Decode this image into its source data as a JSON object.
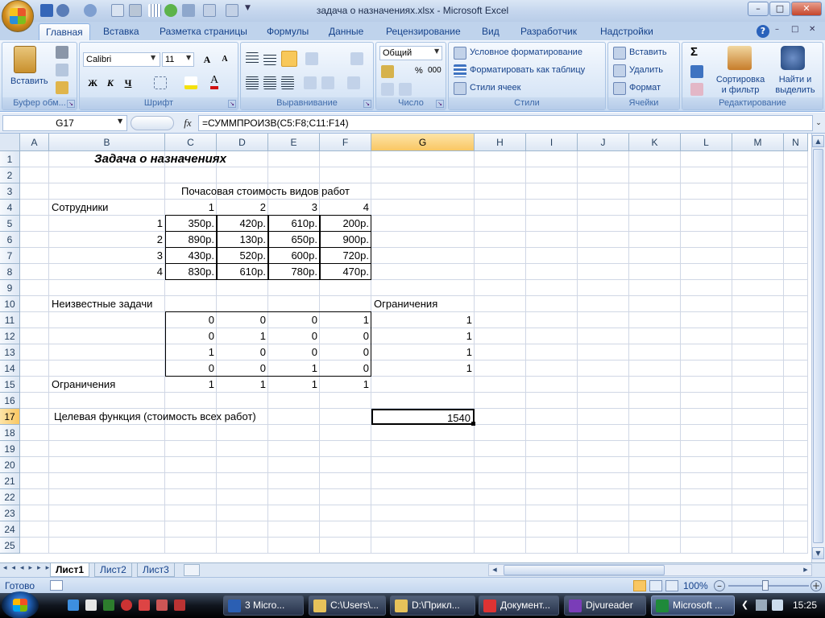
{
  "window": {
    "title": "задача о назначениях.xlsx - Microsoft Excel",
    "min": "–",
    "max": "□",
    "close": "✕"
  },
  "ribbon_tabs": [
    "Главная",
    "Вставка",
    "Разметка страницы",
    "Формулы",
    "Данные",
    "Рецензирование",
    "Вид",
    "Разработчик",
    "Надстройки"
  ],
  "help": "?",
  "groups": {
    "clipboard": {
      "label": "Буфер обм...",
      "paste": "Вставить"
    },
    "font": {
      "label": "Шрифт",
      "font_name": "Calibri",
      "font_size": "11",
      "bold": "Ж",
      "italic": "К",
      "underline": "Ч",
      "grow": "A",
      "shrink": "A"
    },
    "alignment": {
      "label": "Выравнивание"
    },
    "number": {
      "label": "Число",
      "format": "Общий",
      "percent": "%",
      "thousands": "000"
    },
    "styles": {
      "label": "Стили",
      "conditional": "Условное форматирование",
      "as_table": "Форматировать как таблицу",
      "cell_styles": "Стили ячеек"
    },
    "cells": {
      "label": "Ячейки",
      "insert": "Вставить",
      "delete": "Удалить",
      "format": "Формат"
    },
    "editing": {
      "label": "Редактирование",
      "sigma": "Σ",
      "sort": "Сортировка и фильтр",
      "find": "Найти и выделить"
    }
  },
  "formula_bar": {
    "name_box": "G17",
    "fx": "fx",
    "formula": "=СУММПРОИЗВ(C5:F8;C11:F14)"
  },
  "columns": [
    "A",
    "B",
    "C",
    "D",
    "E",
    "F",
    "G",
    "H",
    "I",
    "J",
    "K",
    "L",
    "M",
    "N"
  ],
  "rows": [
    "1",
    "2",
    "3",
    "4",
    "5",
    "6",
    "7",
    "8",
    "9",
    "10",
    "11",
    "12",
    "13",
    "14",
    "15",
    "16",
    "17",
    "18",
    "19",
    "20",
    "21",
    "22",
    "23",
    "24",
    "25"
  ],
  "sheet": {
    "title": "Задача о назначениях",
    "cost_header": "Почасовая стоимость видов работ",
    "employees_label": "Сотрудники",
    "job_numbers": [
      "1",
      "2",
      "3",
      "4"
    ],
    "cost_rows": [
      {
        "n": "1",
        "v": [
          "350р.",
          "420р.",
          "610р.",
          "200р."
        ]
      },
      {
        "n": "2",
        "v": [
          "890р.",
          "130р.",
          "650р.",
          "900р."
        ]
      },
      {
        "n": "3",
        "v": [
          "430р.",
          "520р.",
          "600р.",
          "720р."
        ]
      },
      {
        "n": "4",
        "v": [
          "830р.",
          "610р.",
          "780р.",
          "470р."
        ]
      }
    ],
    "unknown_label": "Неизвестные задачи",
    "constraints_label": "Ограничения",
    "assignment_rows": [
      {
        "v": [
          "0",
          "0",
          "0",
          "1"
        ],
        "g": "1"
      },
      {
        "v": [
          "0",
          "1",
          "0",
          "0"
        ],
        "g": "1"
      },
      {
        "v": [
          "1",
          "0",
          "0",
          "0"
        ],
        "g": "1"
      },
      {
        "v": [
          "0",
          "0",
          "1",
          "0"
        ],
        "g": "1"
      }
    ],
    "col_constraints": [
      "1",
      "1",
      "1",
      "1"
    ],
    "objective_label": "Целевая функция (стоимость всех работ)",
    "objective_value": "1540"
  },
  "sheet_tabs": [
    "Лист1",
    "Лист2",
    "Лист3"
  ],
  "status": {
    "ready": "Готово",
    "zoom": "100%"
  },
  "taskbar": {
    "items": [
      "3 Micro...",
      "C:\\Users\\...",
      "D:\\Прикл...",
      "Документ...",
      "Djvureader",
      "Microsoft ..."
    ],
    "time": "15:25"
  }
}
